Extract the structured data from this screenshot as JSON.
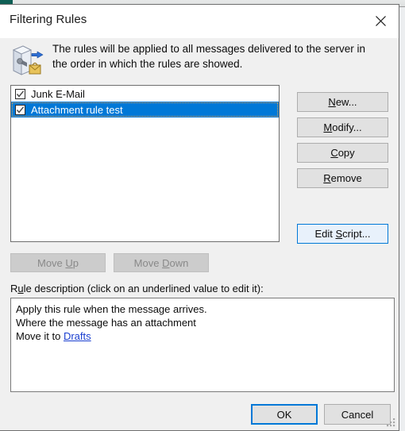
{
  "window": {
    "title": "Filtering Rules",
    "close_icon": "close-icon"
  },
  "header": {
    "icon": "server-mail-rules-icon",
    "text": "The rules will be applied to all messages delivered to the server in the order in which the rules are showed."
  },
  "rules_list": {
    "items": [
      {
        "label": "Junk E-Mail",
        "checked": true,
        "selected": false
      },
      {
        "label": "Attachment rule test",
        "checked": true,
        "selected": true
      }
    ]
  },
  "side_buttons": {
    "new": {
      "label": "New...",
      "accel": "N"
    },
    "modify": {
      "label": "Modify...",
      "accel": "M"
    },
    "copy": {
      "label": "Copy",
      "accel": "C"
    },
    "remove": {
      "label": "Remove",
      "accel": "R"
    },
    "edit_script": {
      "label": "Edit Script...",
      "accel": "S"
    }
  },
  "move_buttons": {
    "move_up": {
      "label": "Move Up",
      "accel": "U",
      "enabled": false
    },
    "move_down": {
      "label": "Move Down",
      "accel": "D",
      "enabled": false
    }
  },
  "description": {
    "label": "Rule description (click on an underlined value to edit it):",
    "label_accel": "u",
    "lines": [
      "Apply this rule when the message arrives.",
      "Where the message has an attachment"
    ],
    "action_prefix": "Move it to ",
    "action_link": "Drafts"
  },
  "footer": {
    "ok": "OK",
    "cancel": "Cancel",
    "resize_grip": "resize-grip"
  },
  "colors": {
    "selection_blue": "#0078d7",
    "focus_blue": "#0078d7",
    "link_blue": "#1a3fd0",
    "dialog_bg": "#f0f0f0",
    "button_bg": "#e1e1e1",
    "backdrop_accent": "#0f5f55"
  }
}
